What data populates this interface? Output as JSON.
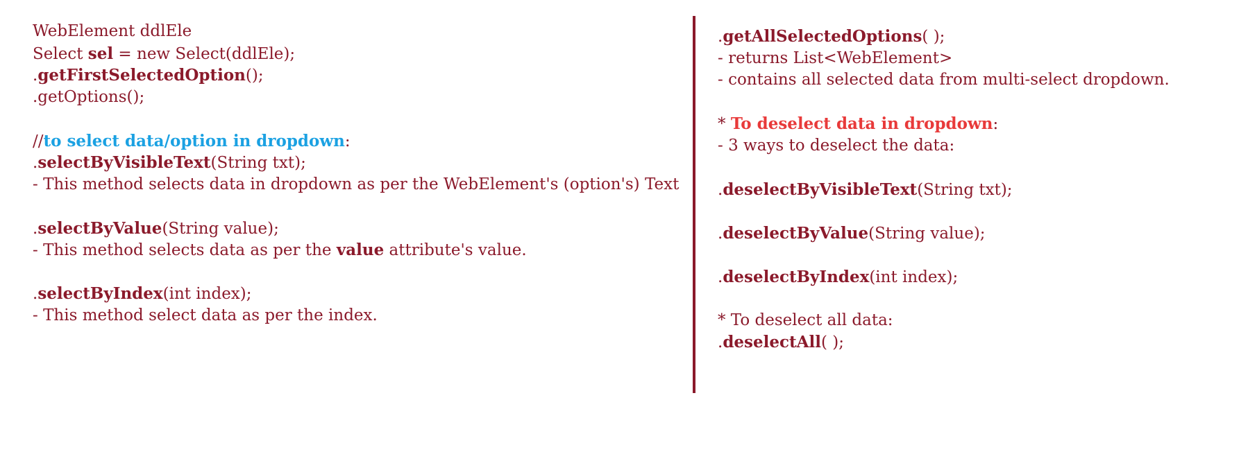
{
  "left": {
    "l1": "WebElement ddlEle",
    "l2": {
      "a": "Select ",
      "b": "sel",
      "c": " = new Select(ddlEle);"
    },
    "l3": {
      "a": ".",
      "b": "getFirstSelectedOption",
      "c": "();"
    },
    "l4": ".getOptions();",
    "l5": {
      "a": "//",
      "b": "to select data/option in dropdown",
      "c": ":"
    },
    "l6": {
      "a": ".",
      "b": "selectByVisibleText",
      "c": "(String txt);"
    },
    "l7": "- This method selects data in dropdown as per the WebElement's (option's) Text",
    "l8": {
      "a": ".",
      "b": "selectByValue",
      "c": "(String value);"
    },
    "l9": {
      "a": "- This method selects data as per the ",
      "b": "value",
      "c": " attribute's value."
    },
    "l10": {
      "a": ".",
      "b": "selectByIndex",
      "c": "(int index);"
    },
    "l11": "- This method select data as per the index."
  },
  "right": {
    "r1": {
      "a": ".",
      "b": "getAllSelectedOptions",
      "c": "( );"
    },
    "r2": "- returns List<WebElement>",
    "r3": "- contains all selected data from multi-select dropdown.",
    "r4": {
      "a": "* ",
      "b": "To deselect data in dropdown",
      "c": ":"
    },
    "r5": "- 3 ways to deselect the data:",
    "r6": {
      "a": ".",
      "b": "deselectByVisibleText",
      "c": "(String txt);"
    },
    "r7": {
      "a": ".",
      "b": "deselectByValue",
      "c": "(String value);"
    },
    "r8": {
      "a": ".",
      "b": "deselectByIndex",
      "c": "(int index);"
    },
    "r9": "* To deselect all data:",
    "r10": {
      "a": ".",
      "b": "deselectAll",
      "c": "( );"
    }
  },
  "colors": {
    "text": "#8b1a2b",
    "heading_blue": "#1ba1e2",
    "heading_red": "#e83a3a",
    "divider": "#8b1a2b"
  }
}
